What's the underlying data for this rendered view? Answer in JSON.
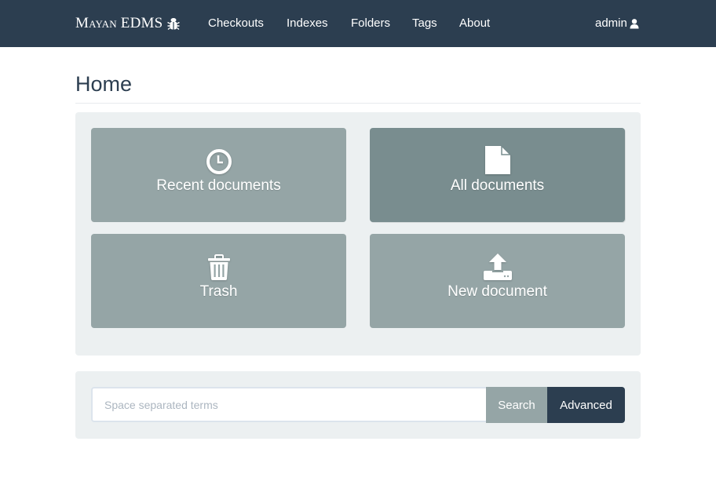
{
  "navbar": {
    "brand": {
      "first": "Mayan",
      "second": "EDMS",
      "icon": "bug-icon"
    },
    "items": [
      {
        "label": "Checkouts"
      },
      {
        "label": "Indexes"
      },
      {
        "label": "Folders"
      },
      {
        "label": "Tags"
      },
      {
        "label": "About"
      }
    ],
    "user": {
      "label": "admin",
      "icon": "user-icon"
    }
  },
  "page": {
    "title": "Home"
  },
  "tiles": [
    {
      "label": "Recent documents",
      "icon": "clock-icon",
      "active": false
    },
    {
      "label": "All documents",
      "icon": "file-icon",
      "active": true
    },
    {
      "label": "Trash",
      "icon": "trash-icon",
      "active": false
    },
    {
      "label": "New document",
      "icon": "upload-icon",
      "active": false
    }
  ],
  "search": {
    "placeholder": "Space separated terms",
    "value": "",
    "search_label": "Search",
    "advanced_label": "Advanced"
  },
  "colors": {
    "navbar": "#2c3e50",
    "tile": "#95a5a6",
    "tile_active": "#798d8f",
    "well": "#ecf0f1",
    "primary": "#2c3e50"
  }
}
